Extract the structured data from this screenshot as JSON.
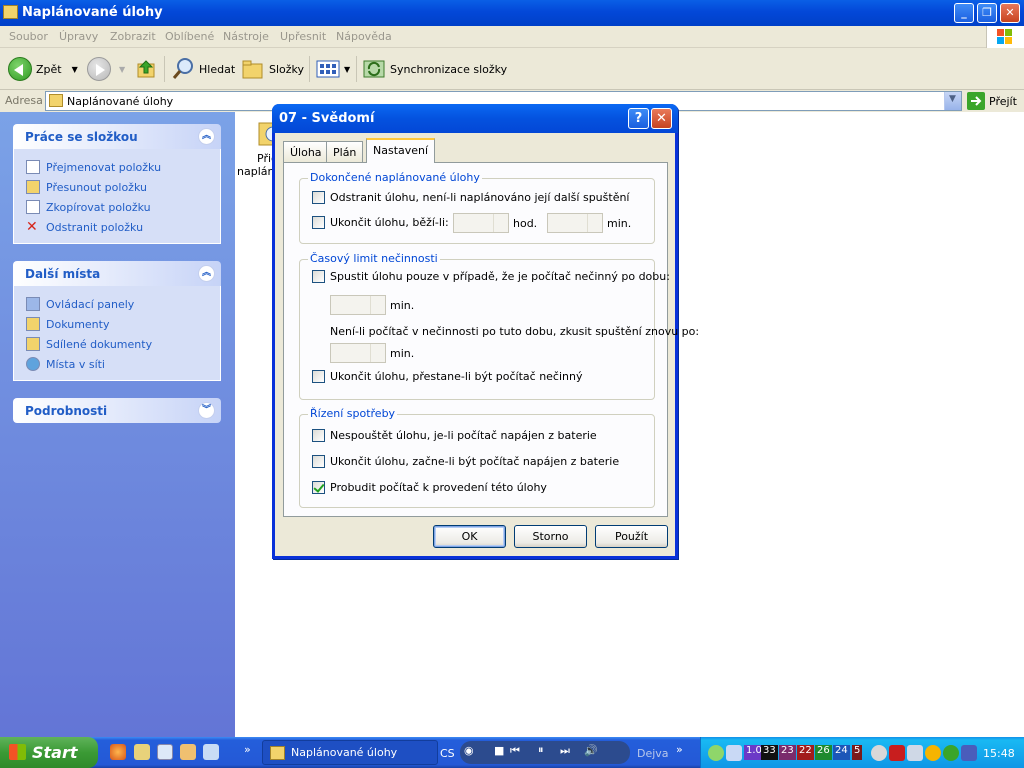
{
  "window": {
    "title": "Naplánované úlohy"
  },
  "menu": [
    "Soubor",
    "Úpravy",
    "Zobrazit",
    "Oblíbené",
    "Nástroje",
    "Upřesnit",
    "Nápověda"
  ],
  "toolbar": {
    "back_label": "Zpět",
    "search_label": "Hledat",
    "folders_label": "Složky",
    "sync_label": "Synchronizace složky"
  },
  "address": {
    "label": "Adresa",
    "value": "Naplánované úlohy",
    "go_label": "Přejít"
  },
  "sidebar": {
    "folder_tasks": {
      "title": "Práce se složkou",
      "items": [
        "Přejmenovat položku",
        "Přesunout položku",
        "Zkopírovat položku",
        "Odstranit položku"
      ]
    },
    "other_places": {
      "title": "Další místa",
      "items": [
        "Ovládací panely",
        "Dokumenty",
        "Sdílené dokumenty",
        "Místa v síti"
      ]
    },
    "details": {
      "title": "Podrobnosti"
    }
  },
  "content": {
    "item_label_1": "Přid",
    "item_label_2": "naplán"
  },
  "dialog": {
    "title": "07 - Svědomí",
    "tabs": [
      "Úloha",
      "Plán",
      "Nastavení"
    ],
    "selected_tab": "Nastavení",
    "group1": {
      "title": "Dokončené naplánované úlohy",
      "delete_label": "Odstranit úlohu, není-li naplánováno její další spuštění",
      "delete_checked": false,
      "stop_label": "Ukončit úlohu, běží-li:",
      "stop_checked": false,
      "hours_unit": "hod.",
      "min_unit": "min."
    },
    "group2": {
      "title": "Časový limit nečinnosti",
      "start_idle_label": "Spustit úlohu pouze v případě, že je počítač nečinný po dobu:",
      "start_idle_checked": false,
      "min_unit": "min.",
      "retry_label": "Není-li počítač v nečinnosti po tuto dobu, zkusit spuštění znovu po:",
      "retry_unit": "min.",
      "stop_idle_label": "Ukončit úlohu, přestane-li být počítač nečinný",
      "stop_idle_checked": false
    },
    "group3": {
      "title": "Řízení spotřeby",
      "no_battery_label": "Nespouštět úlohu, je-li počítač napájen z baterie",
      "no_battery_checked": false,
      "stop_battery_label": "Ukončit úlohu, začne-li být počítač napájen z baterie",
      "stop_battery_checked": false,
      "wake_label": "Probudit počítač k provedení této úlohy",
      "wake_checked": true
    },
    "buttons": {
      "ok": "OK",
      "cancel": "Storno",
      "apply": "Použít"
    }
  },
  "taskbar": {
    "start_label": "Start",
    "task_label": "Naplánované úlohy",
    "lang": "CS",
    "player_text": "Dejva",
    "tray_numbers": [
      "1.0",
      "33",
      "23",
      "22",
      "26",
      "24",
      "5"
    ],
    "clock": "15:48"
  }
}
